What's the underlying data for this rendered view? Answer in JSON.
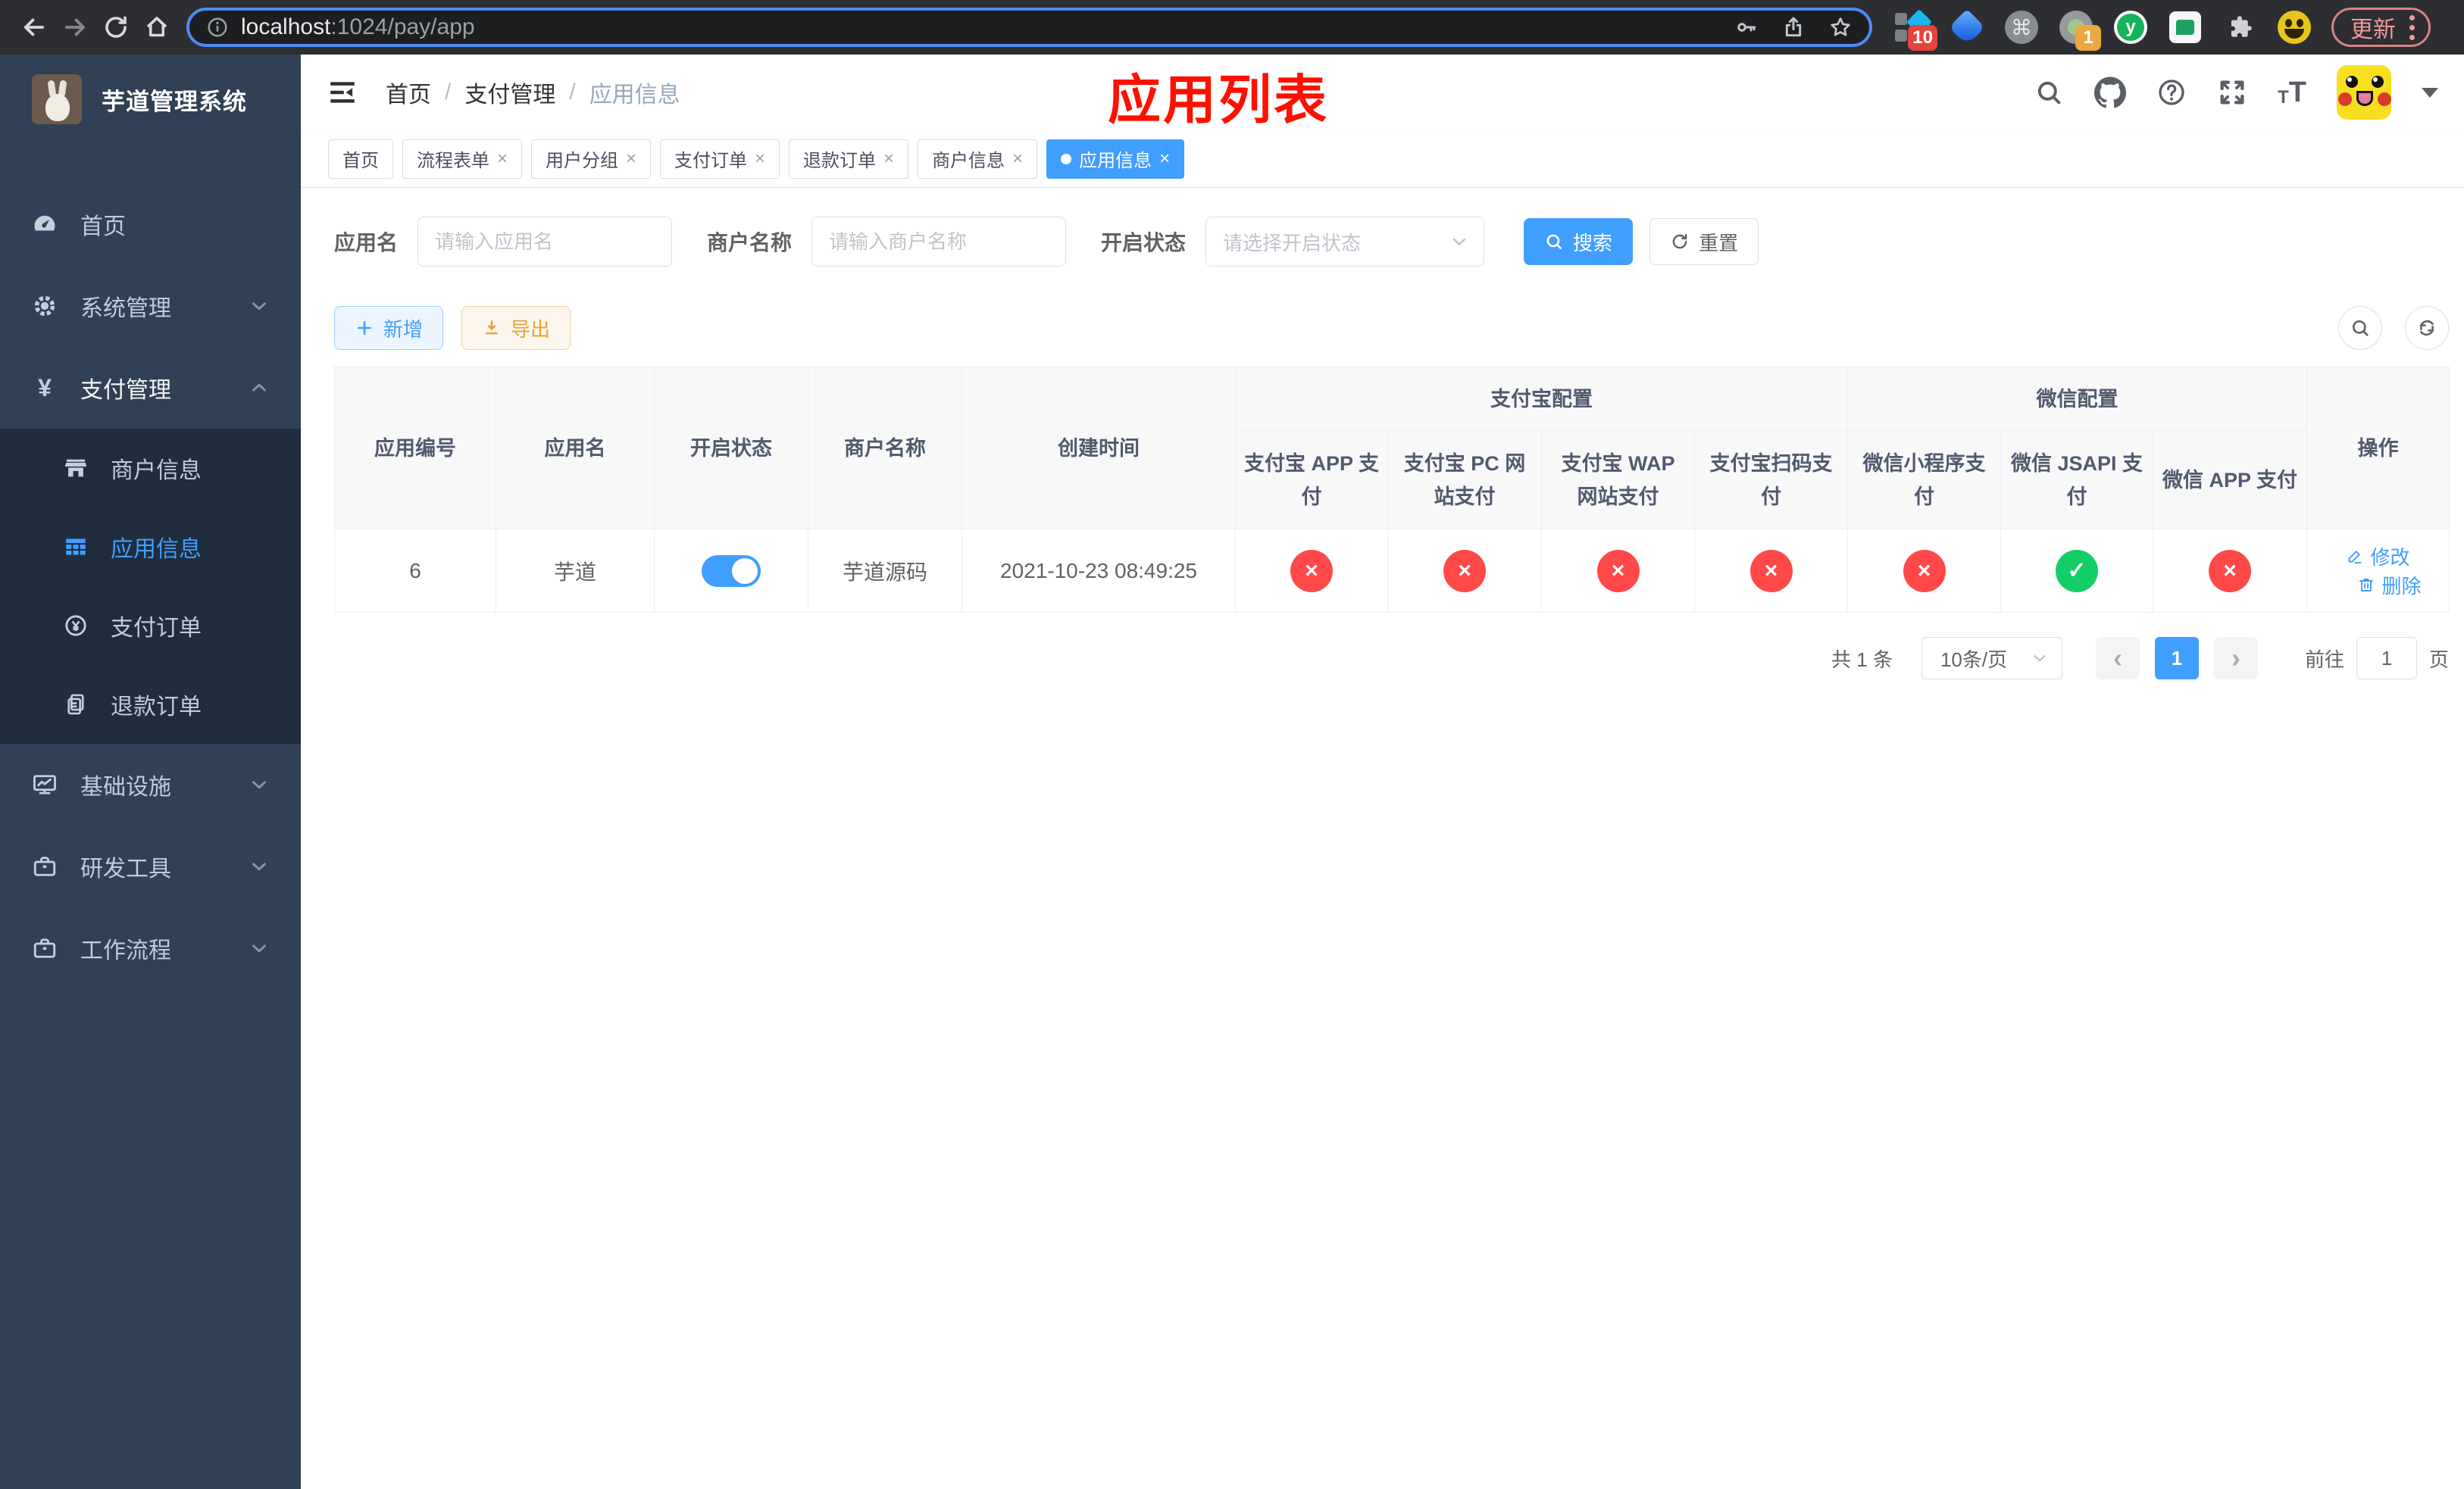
{
  "browser": {
    "url_host": "localhost",
    "url_rest": ":1024/pay/app",
    "update_label": "更新",
    "badge_diamond": "10",
    "badge_record": "1",
    "yuque_letter": "y",
    "cmd_glyph": "⌘"
  },
  "sidebar": {
    "title": "芋道管理系统",
    "items": {
      "home": "首页",
      "system": "系统管理",
      "pay": "支付管理",
      "merchant": "商户信息",
      "app": "应用信息",
      "order": "支付订单",
      "refund": "退款订单",
      "infra": "基础设施",
      "dev": "研发工具",
      "workflow": "工作流程"
    },
    "yen_glyph": "¥"
  },
  "navbar": {
    "breadcrumb": [
      "首页",
      "支付管理",
      "应用信息"
    ],
    "separator": "/",
    "annotation": "应用列表"
  },
  "tabs": [
    {
      "label": "首页",
      "closable": false
    },
    {
      "label": "流程表单",
      "closable": true
    },
    {
      "label": "用户分组",
      "closable": true
    },
    {
      "label": "支付订单",
      "closable": true
    },
    {
      "label": "退款订单",
      "closable": true
    },
    {
      "label": "商户信息",
      "closable": true
    },
    {
      "label": "应用信息",
      "closable": true,
      "active": true
    }
  ],
  "tab_close_glyph": "×",
  "filters": {
    "app_name_label": "应用名",
    "app_name_placeholder": "请输入应用名",
    "merchant_label": "商户名称",
    "merchant_placeholder": "请输入商户名称",
    "status_label": "开启状态",
    "status_placeholder": "请选择开启状态",
    "search_label": "搜索",
    "reset_label": "重置"
  },
  "toolbar": {
    "add_label": "新增",
    "export_label": "导出"
  },
  "table": {
    "headers": {
      "id": "应用编号",
      "name": "应用名",
      "status": "开启状态",
      "merchant": "商户名称",
      "created": "创建时间",
      "alipay_group": "支付宝配置",
      "wechat_group": "微信配置",
      "action": "操作",
      "alipay_app": "支付宝 APP 支付",
      "alipay_pc": "支付宝 PC 网站支付",
      "alipay_wap": "支付宝 WAP 网站支付",
      "alipay_qr": "支付宝扫码支付",
      "wx_mini": "微信小程序支付",
      "wx_jsapi": "微信 JSAPI 支付",
      "wx_app": "微信 APP 支付"
    },
    "row": {
      "id": "6",
      "name": "芋道",
      "enabled": true,
      "merchant": "芋道源码",
      "created": "2021-10-23 08:49:25",
      "configs": [
        false,
        false,
        false,
        false,
        false,
        true,
        false
      ],
      "edit_label": "修改",
      "delete_label": "删除"
    },
    "glyphs": {
      "ok": "✓",
      "fail": "×"
    }
  },
  "pagination": {
    "total": "共 1 条",
    "page_size": "10条/页",
    "page": "1",
    "prev_glyph": "‹",
    "next_glyph": "›",
    "goto_label": "前往",
    "goto_value": "1",
    "goto_suffix": "页"
  },
  "colors": {
    "accent": "#409EFF",
    "success": "#13ce66",
    "danger": "#ff4949",
    "warning": "#e6a23c",
    "annotation_red": "#fe1000"
  }
}
